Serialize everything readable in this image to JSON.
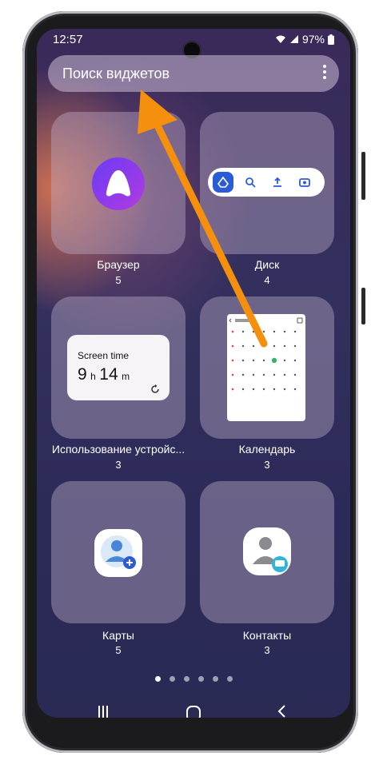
{
  "status_bar": {
    "time": "12:57",
    "battery": "97%"
  },
  "search": {
    "placeholder": "Поиск виджетов"
  },
  "widgets": [
    {
      "label": "Браузер",
      "count": "5"
    },
    {
      "label": "Диск",
      "count": "4"
    },
    {
      "label": "Использование устройс...",
      "count": "3",
      "preview": {
        "title": "Screen time",
        "hours": "9",
        "h_unit": "h",
        "minutes": "14",
        "m_unit": "m"
      }
    },
    {
      "label": "Календарь",
      "count": "3"
    },
    {
      "label": "Карты",
      "count": "5"
    },
    {
      "label": "Контакты",
      "count": "3"
    }
  ],
  "page_indicator": {
    "count": 6,
    "active": 0
  },
  "colors": {
    "alice_purple": "#8a3cf0",
    "arrow_orange": "#f5900f",
    "disk_accent": "#2b5bd7"
  },
  "icons": [
    "wifi-icon",
    "signal-icon",
    "battery-icon",
    "more-icon",
    "recents-icon",
    "home-icon",
    "back-icon"
  ]
}
